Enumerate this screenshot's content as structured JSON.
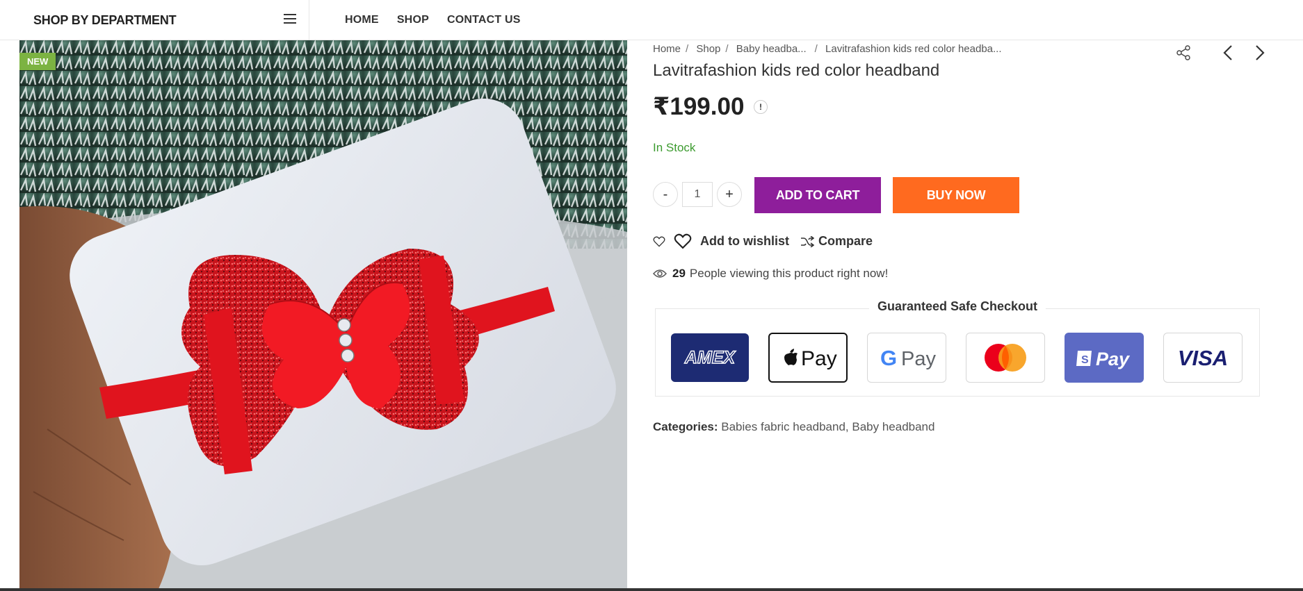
{
  "header": {
    "dept_title": "SHOP BY DEPARTMENT",
    "nav": [
      "HOME",
      "SHOP",
      "CONTACT US"
    ]
  },
  "gallery": {
    "badge": "NEW"
  },
  "breadcrumb": {
    "items": [
      "Home",
      "Shop",
      "Baby headba...",
      "Lavitrafashion kids red color headba..."
    ]
  },
  "product": {
    "title": "Lavitrafashion kids red color headband",
    "price": "₹199.00",
    "info_icon": "!",
    "stock": "In Stock",
    "quantity": "1",
    "minus": "-",
    "plus": "+",
    "add_to_cart": "ADD TO CART",
    "buy_now": "BUY NOW",
    "wishlist": "Add to wishlist",
    "compare": "Compare",
    "viewers_count": "29",
    "viewers_text": "People viewing this product right now!"
  },
  "checkout": {
    "title": "Guaranteed Safe Checkout",
    "cards": [
      "AMEX",
      "Apple Pay",
      "G Pay",
      "Mastercard",
      "Shop Pay",
      "VISA"
    ]
  },
  "categories": {
    "label": "Categories:",
    "items": [
      "Babies fabric headband",
      "Baby headband"
    ]
  },
  "colors": {
    "cart_button": "#8e1e9b",
    "buy_button": "#ff6a1f",
    "stock": "#3c9b2f",
    "new_badge": "#7cb342"
  }
}
